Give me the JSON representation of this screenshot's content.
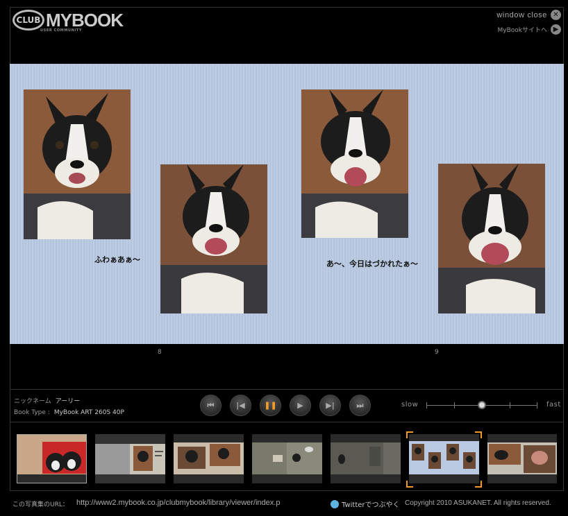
{
  "header": {
    "logo_club": "CLUB",
    "logo_mybook": "MYBOOK",
    "logo_sub": "USER COMMUNITY",
    "window_close": "window close",
    "site_link": "MyBookサイトへ"
  },
  "book": {
    "captions": [
      "ふわぁあぁ〜",
      "あ〜、今日はづかれたぁ〜"
    ],
    "page_left": "8",
    "page_right": "9"
  },
  "info": {
    "nickname_label": "ニックネーム",
    "nickname_value": "アーリー",
    "booktype_label": "Book Type :",
    "booktype_value": "MyBook ART 260S 40P"
  },
  "speed": {
    "slow": "slow",
    "fast": "fast",
    "level": 0.5
  },
  "player": {
    "state": "playing"
  },
  "footer": {
    "url_label": "この写真集のURL：",
    "url_value": "http://www2.mybook.co.jp/clubmybook/library/viewer/index.p",
    "twitter": "Twitterでつぶやく",
    "copyright": "Copyright 2010 ASUKANET. All rights reserved."
  },
  "colors": {
    "accent": "#f39b2a",
    "page_bg": "#b9c9e1"
  },
  "icons": [
    "close-icon",
    "play-icon",
    "first-icon",
    "prev-icon",
    "pause-icon",
    "next-icon",
    "last-icon",
    "twitter-icon"
  ]
}
